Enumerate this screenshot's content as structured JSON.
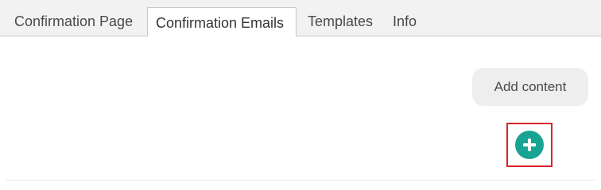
{
  "tabs": [
    {
      "label": "Confirmation Page",
      "active": false
    },
    {
      "label": "Confirmation Emails",
      "active": true
    },
    {
      "label": "Templates",
      "active": false
    },
    {
      "label": "Info",
      "active": false
    }
  ],
  "content": {
    "add_content_label": "Add content",
    "add_button_icon": "plus-icon"
  },
  "colors": {
    "accent": "#19a392",
    "highlight": "#d8232a"
  }
}
